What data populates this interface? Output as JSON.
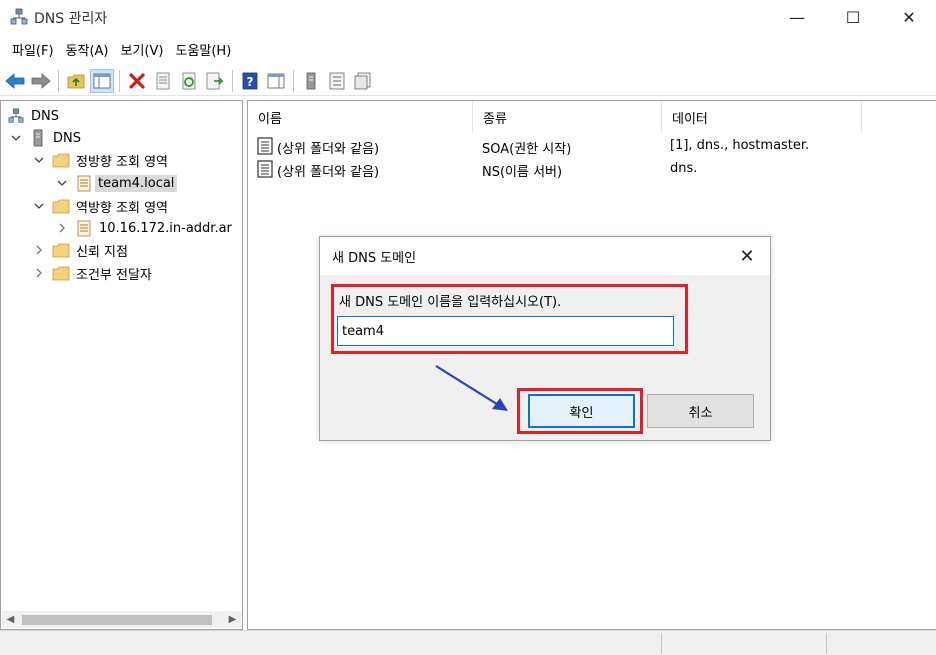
{
  "window": {
    "title": "DNS 관리자",
    "controls": {
      "minimize": "—",
      "maximize": "☐",
      "close": "✕"
    }
  },
  "menu": [
    "파일(F)",
    "동작(A)",
    "보기(V)",
    "도움말(H)"
  ],
  "toolbar": {
    "buttons": [
      "back-icon",
      "forward-icon",
      "up-folder-icon",
      "show-console-tree-icon",
      "delete-icon",
      "properties-icon",
      "refresh-icon",
      "export-icon",
      "help-icon",
      "action-pane-icon",
      "server-icon",
      "list-icon",
      "detail-icon"
    ]
  },
  "tree": {
    "root": "DNS",
    "server": "DNS",
    "forward_zones": "정방향 조회 영역",
    "zone_team4": "team4.local",
    "reverse_zones": "역방향 조회 영역",
    "reverse_zone": "10.16.172.in-addr.ar",
    "trust_points": "신뢰 지점",
    "conditional_forwarders": "조건부 전달자"
  },
  "list": {
    "columns": [
      "이름",
      "종류",
      "데이터"
    ],
    "rows": [
      {
        "name": "(상위 폴더와 같음)",
        "type": "SOA(권한 시작)",
        "data": "[1], dns., hostmaster."
      },
      {
        "name": "(상위 폴더와 같음)",
        "type": "NS(이름 서버)",
        "data": "dns."
      }
    ]
  },
  "dialog": {
    "title": "새 DNS 도메인",
    "prompt": "새 DNS 도메인 이름을 입력하십시오(T).",
    "input_value": "team4",
    "ok_label": "확인",
    "cancel_label": "취소",
    "close_glyph": "✕"
  },
  "colors": {
    "highlight": "#e0202a",
    "arrow": "#2e3fbf",
    "accent": "#0078d7"
  }
}
